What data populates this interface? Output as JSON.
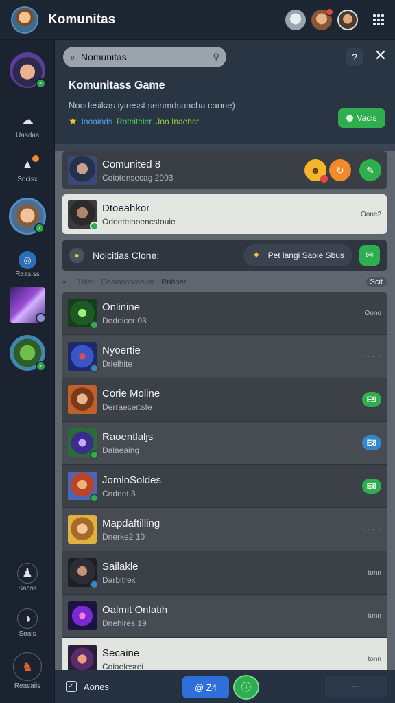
{
  "app": {
    "title": "Komunitas"
  },
  "rail": {
    "items": [
      {
        "label": ""
      },
      {
        "label": "Uasdas"
      },
      {
        "label": "Socisx"
      },
      {
        "label": ""
      },
      {
        "label": "Reasiss"
      },
      {
        "label": ""
      },
      {
        "label": ""
      },
      {
        "label": "Sacss"
      },
      {
        "label": "Seais"
      },
      {
        "label": "Reasaiis"
      }
    ]
  },
  "search": {
    "value": "Nomunitas",
    "placeholder": "Nomunitas corn"
  },
  "card": {
    "title": "Komunitass Game",
    "description": "Noodesikas iyiresst seinmdsoacha canoe)",
    "tags": [
      "Iooainds",
      "Roteiteier",
      "Joo Inaehcr"
    ],
    "vote_label": "Vadis"
  },
  "featured": {
    "name": "Comunited 8",
    "subtitle": "Coiotensecag 2903"
  },
  "selected": {
    "name": "Dtoeahkor",
    "subtitle": "Odoeteinoencstouie",
    "right": "Oone2"
  },
  "notification": {
    "text": "Nolcitias Clone:",
    "pill_text": "Pet langi Saoie Sbus"
  },
  "filters": {
    "f1": "Thlet",
    "f2": "Oeainenoraeiier",
    "f3": "Rnhoer",
    "f4": "Scit"
  },
  "rows": [
    {
      "name": "Onlinine",
      "sub": "Dedeicer 03",
      "right": "Oono",
      "style": "r-dark"
    },
    {
      "name": "Nyoertie",
      "sub": "Drielhite",
      "right": "- - - -",
      "style": "r-mid"
    },
    {
      "name": "Corie Moline",
      "sub": "Derraecer:ste",
      "right": "E9",
      "style": "r-dark"
    },
    {
      "name": "Raoentlaljs",
      "sub": "Dalaeaing",
      "right": "E8",
      "style": "r-mid"
    },
    {
      "name": "JomloSoldes",
      "sub": "Cndnet 3",
      "right": "E8",
      "style": "r-dark"
    },
    {
      "name": "Mapdaftilling",
      "sub": "Dnerke2 10",
      "right": "- - - -",
      "style": "r-mid"
    },
    {
      "name": "Sailakle",
      "sub": "Darbitrex",
      "right": "tonn",
      "style": "r-dark"
    },
    {
      "name": "Oalmit Onlatih",
      "sub": "Dnehlres 19",
      "right": "tonn",
      "style": "r-mid"
    },
    {
      "name": "Secaine",
      "sub": "Coiaelesrei",
      "right": "tonn",
      "style": "r-light"
    }
  ],
  "bottom": {
    "left": "Aones",
    "primary": "Z4",
    "right": ""
  },
  "colors": {
    "accent": "#2fae4f",
    "primary": "#2f6fdc",
    "background": "#1f2836"
  }
}
